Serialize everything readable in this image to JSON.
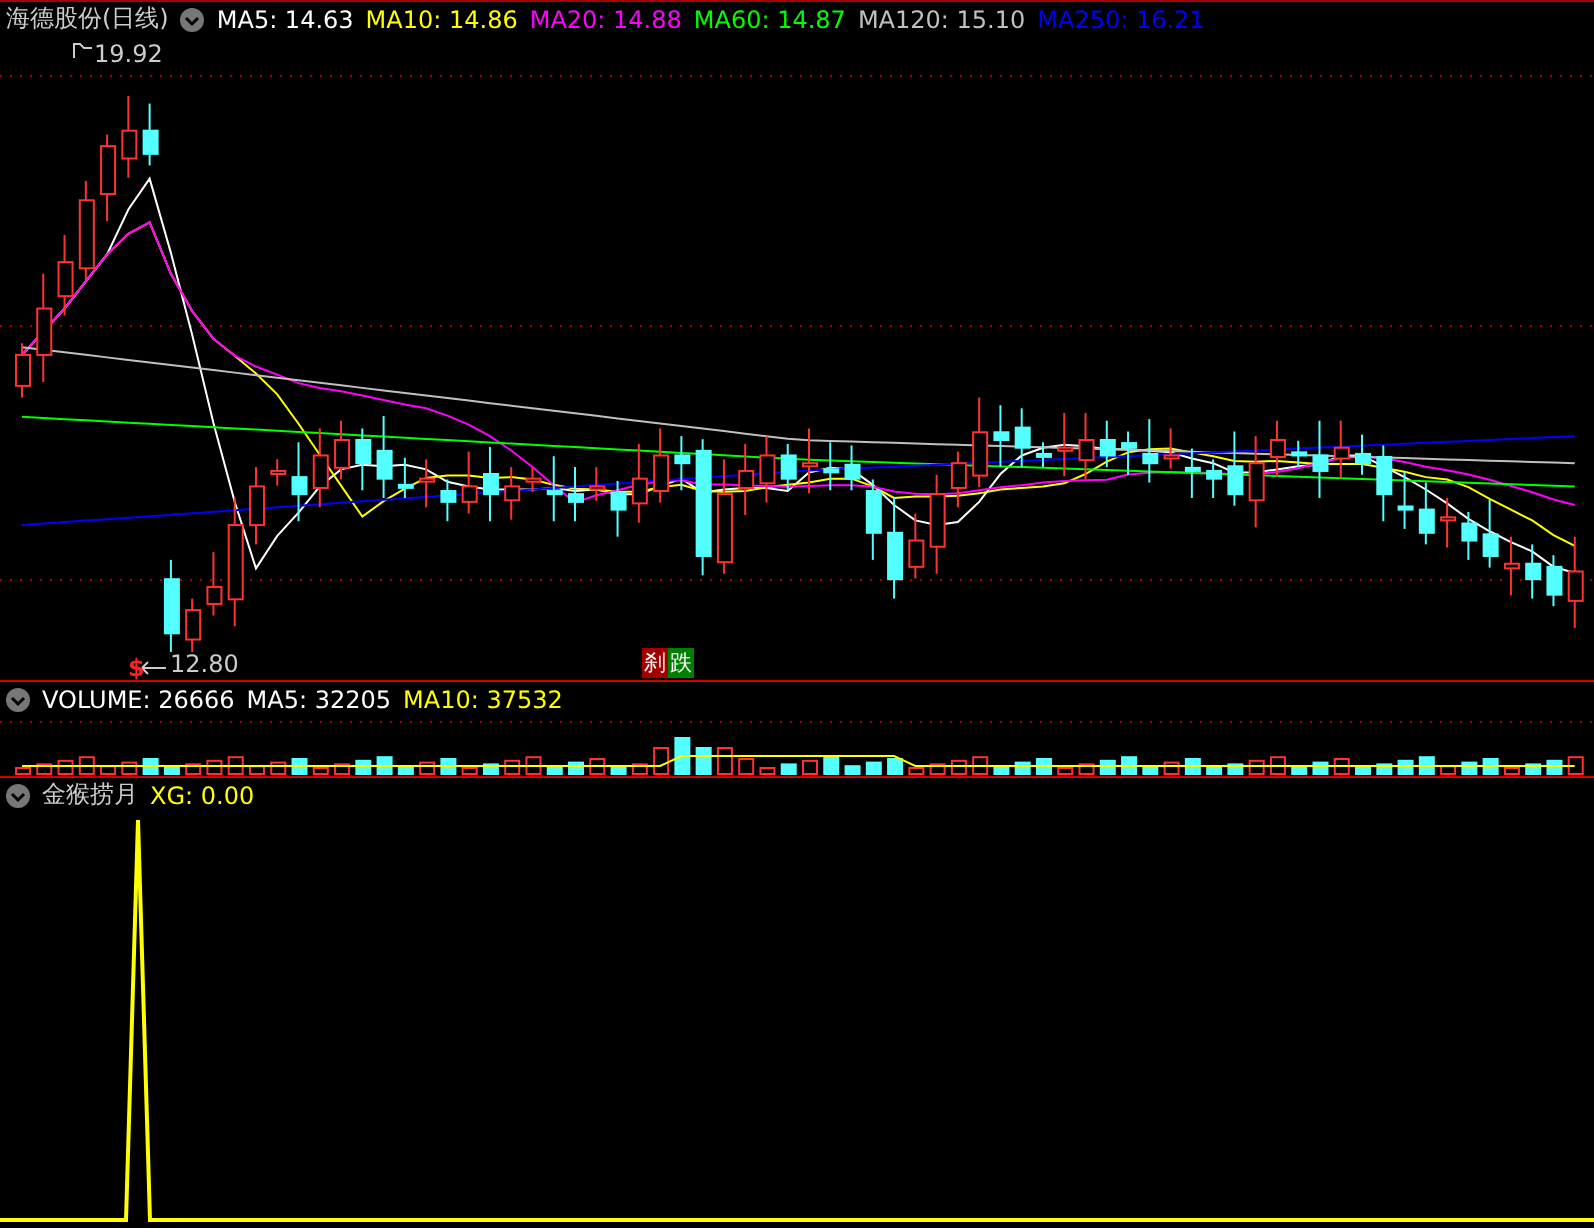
{
  "title": "海德股份(日线)",
  "ma_labels": [
    {
      "text": "MA5: 14.63",
      "color": "#ffffff"
    },
    {
      "text": "MA10: 14.86",
      "color": "#ffff00"
    },
    {
      "text": "MA20: 14.88",
      "color": "#ff00ff"
    },
    {
      "text": "MA60: 14.87",
      "color": "#00ff00"
    },
    {
      "text": "MA120: 15.10",
      "color": "#c0c0c0"
    },
    {
      "text": "MA250: 16.21",
      "color": "#0000ff"
    }
  ],
  "price_chart": {
    "high_label": "19.92",
    "low_label": "12.80",
    "signal_mark": "$",
    "badges": [
      {
        "text": "刹",
        "color": "#a00000"
      },
      {
        "text": "跌",
        "color": "#008000"
      }
    ]
  },
  "volume": {
    "labels": [
      {
        "text": "VOLUME: 26666",
        "color": "#ffffff"
      },
      {
        "text": "MA5: 32205",
        "color": "#ffffff"
      },
      {
        "text": "MA10: 37532",
        "color": "#ffff00"
      }
    ]
  },
  "indicator": {
    "name": "金猴捞月",
    "labels": [
      {
        "text": "XG: 0.00",
        "color": "#ffff00"
      }
    ]
  }
}
